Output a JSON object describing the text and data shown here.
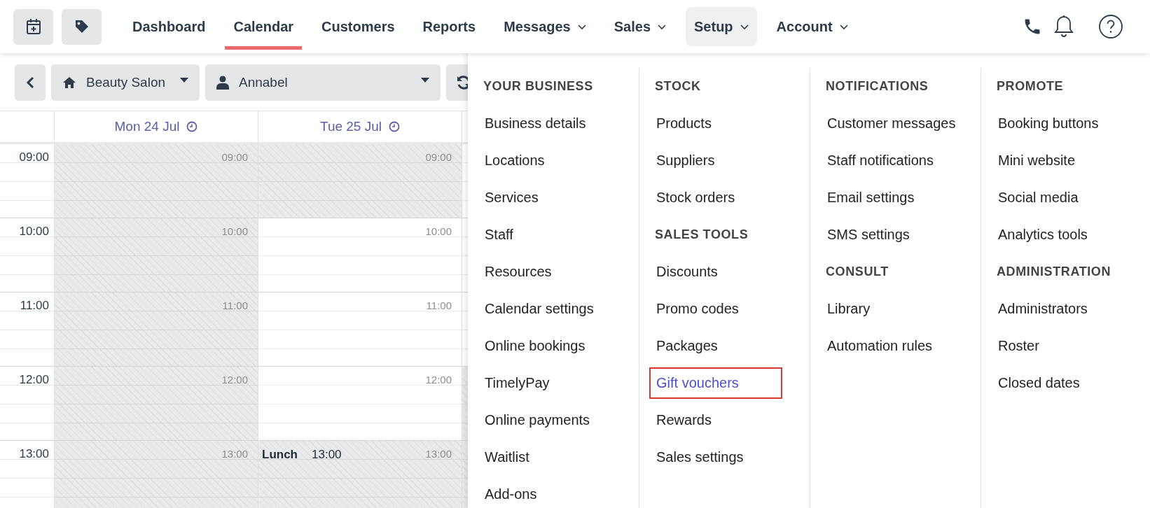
{
  "nav": {
    "items": [
      {
        "label": "Dashboard",
        "selected": false,
        "dropdown": false,
        "expanded": false
      },
      {
        "label": "Calendar",
        "selected": true,
        "dropdown": false,
        "expanded": false
      },
      {
        "label": "Customers",
        "selected": false,
        "dropdown": false,
        "expanded": false
      },
      {
        "label": "Reports",
        "selected": false,
        "dropdown": false,
        "expanded": false
      },
      {
        "label": "Messages",
        "selected": false,
        "dropdown": true,
        "expanded": false
      },
      {
        "label": "Sales",
        "selected": false,
        "dropdown": true,
        "expanded": false
      },
      {
        "label": "Setup",
        "selected": false,
        "dropdown": true,
        "expanded": true
      },
      {
        "label": "Account",
        "selected": false,
        "dropdown": true,
        "expanded": false
      }
    ]
  },
  "toolbar": {
    "location": "Beauty Salon",
    "staff": "Annabel"
  },
  "calendar": {
    "times": [
      "09:00",
      "10:00",
      "11:00",
      "12:00",
      "13:00"
    ],
    "days": [
      {
        "label": "Mon 24 Jul",
        "slots": [
          {
            "time": "09:00",
            "blocked": true
          },
          {
            "time": "10:00",
            "blocked": true
          },
          {
            "time": "11:00",
            "blocked": true
          },
          {
            "time": "12:00",
            "blocked": true
          },
          {
            "time": "13:00",
            "blocked": true
          }
        ]
      },
      {
        "label": "Tue 25 Jul",
        "slots": [
          {
            "time": "09:00",
            "blocked": true
          },
          {
            "time": "10:00",
            "blocked": false
          },
          {
            "time": "11:00",
            "blocked": false
          },
          {
            "time": "12:00",
            "blocked": false
          },
          {
            "time": "13:00",
            "blocked": true,
            "event": "Lunch",
            "event_time": "13:00"
          }
        ]
      }
    ]
  },
  "setup_menu": {
    "columns": [
      {
        "sections": [
          {
            "heading": "YOUR BUSINESS",
            "items": [
              {
                "label": "Business details",
                "selected": false
              },
              {
                "label": "Locations",
                "selected": false
              },
              {
                "label": "Services",
                "selected": false
              },
              {
                "label": "Staff",
                "selected": false
              },
              {
                "label": "Resources",
                "selected": false
              },
              {
                "label": "Calendar settings",
                "selected": false
              },
              {
                "label": "Online bookings",
                "selected": false
              },
              {
                "label": "TimelyPay",
                "selected": false
              },
              {
                "label": "Online payments",
                "selected": false
              },
              {
                "label": "Waitlist",
                "selected": false
              },
              {
                "label": "Add-ons",
                "selected": false
              }
            ]
          }
        ]
      },
      {
        "sections": [
          {
            "heading": "STOCK",
            "items": [
              {
                "label": "Products",
                "selected": false
              },
              {
                "label": "Suppliers",
                "selected": false
              },
              {
                "label": "Stock orders",
                "selected": false
              }
            ]
          },
          {
            "heading": "SALES TOOLS",
            "items": [
              {
                "label": "Discounts",
                "selected": false
              },
              {
                "label": "Promo codes",
                "selected": false
              },
              {
                "label": "Packages",
                "selected": false
              },
              {
                "label": "Gift vouchers",
                "selected": true
              },
              {
                "label": "Rewards",
                "selected": false
              },
              {
                "label": "Sales settings",
                "selected": false
              }
            ]
          }
        ]
      },
      {
        "sections": [
          {
            "heading": "NOTIFICATIONS",
            "items": [
              {
                "label": "Customer messages",
                "selected": false
              },
              {
                "label": "Staff notifications",
                "selected": false
              },
              {
                "label": "Email settings",
                "selected": false
              },
              {
                "label": "SMS settings",
                "selected": false
              }
            ]
          },
          {
            "heading": "CONSULT",
            "items": [
              {
                "label": "Library",
                "selected": false
              },
              {
                "label": "Automation rules",
                "selected": false
              }
            ]
          }
        ]
      },
      {
        "sections": [
          {
            "heading": "PROMOTE",
            "items": [
              {
                "label": "Booking buttons",
                "selected": false
              },
              {
                "label": "Mini website",
                "selected": false
              },
              {
                "label": "Social media",
                "selected": false
              },
              {
                "label": "Analytics tools",
                "selected": false
              }
            ]
          },
          {
            "heading": "ADMINISTRATION",
            "items": [
              {
                "label": "Administrators",
                "selected": false
              },
              {
                "label": "Roster",
                "selected": false
              },
              {
                "label": "Closed dates",
                "selected": false
              }
            ]
          }
        ]
      }
    ]
  }
}
